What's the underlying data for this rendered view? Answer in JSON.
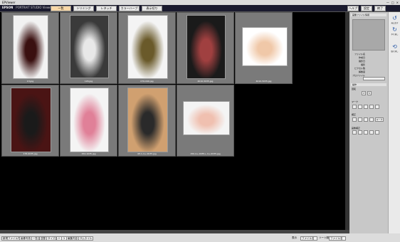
{
  "window": {
    "title": "EPViewer",
    "controls": [
      "—",
      "□",
      "×"
    ]
  },
  "header": {
    "brand": "EPSON",
    "product": "PORTRAIT STUDIO Viewer",
    "tabs": [
      {
        "label": "一覧"
      },
      {
        "label": "トリミング"
      },
      {
        "label": "レタッチ"
      },
      {
        "label": "カラーハーブ"
      },
      {
        "label": "表示切り"
      }
    ],
    "right_buttons": [
      {
        "label": "ヘルプ"
      },
      {
        "label": "設定"
      },
      {
        "label": "終了"
      }
    ]
  },
  "photos": [
    {
      "caption": "13.jpg",
      "tone": "#f2f2f2",
      "subject": "#3a1010"
    },
    {
      "caption": "129.jpg",
      "tone": "#3a3a3a",
      "subject": "#e8e8e8"
    },
    {
      "caption": "070-040.jpg",
      "tone": "#f4f4f4",
      "subject": "#6a5a2a"
    },
    {
      "caption": "4010-5035.jpg",
      "tone": "#1a1a1a",
      "subject": "#a04040"
    },
    {
      "caption": "4010-5035.jpg",
      "tone": "#ffffff",
      "subject": "#f0c8a8"
    },
    {
      "caption": "178-0035.jpg",
      "tone": "#4a1414",
      "subject": "#1a1a1a"
    },
    {
      "caption": "154-1035.jpg",
      "tone": "#f4f4f4",
      "subject": "#e08098"
    },
    {
      "caption": "0P-1-4+-0035.jpg",
      "tone": "#d0a070",
      "subject": "#2a2a2a"
    },
    {
      "caption": "150-4+-0035+-4+-0035.jpg",
      "tone": "#f4f4f4",
      "subject": "#f0c0b0"
    }
  ],
  "panel": {
    "file_info_header": "画像ファイル情報",
    "info_labels": [
      "ファイル名",
      "作成日",
      "撮影日",
      "撮影",
      "ピクセル数",
      "解像度",
      "プロファイル"
    ],
    "operation_header": "操作",
    "sections": [
      "回転",
      "マーク",
      "補正",
      "画像補正"
    ],
    "mark_button": "マーク"
  },
  "side": {
    "buttons": [
      {
        "icon": "↺",
        "label": "元に戻す"
      },
      {
        "icon": "↻",
        "label": "やり直し"
      },
      {
        "icon": "⟲",
        "label": "取り消し"
      }
    ]
  },
  "status": {
    "items": [
      "新規ファイル作成",
      "画像写真",
      "一覧",
      "並替",
      "サイズ",
      "ハ",
      "ユ",
      "編集内容",
      "サムネイル"
    ],
    "right_label": "表示",
    "fields": [
      {
        "label": "ファイル名",
        "value": "ファイル名"
      },
      {
        "label": "ソート順",
        "value": "ファイル名"
      }
    ]
  }
}
